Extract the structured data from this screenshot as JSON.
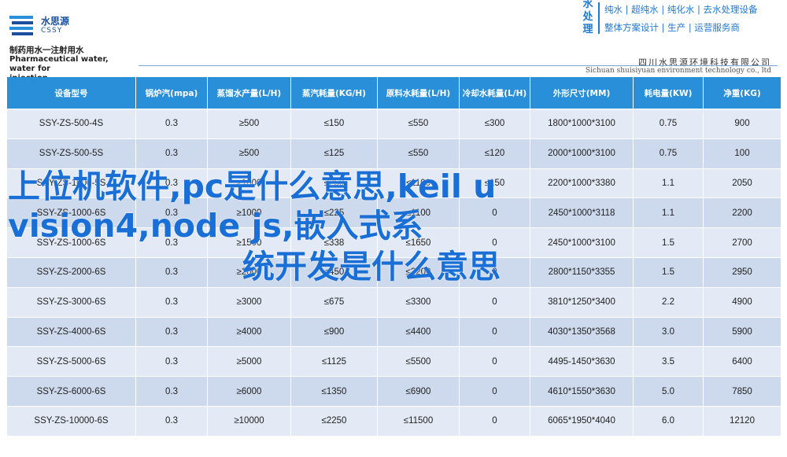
{
  "header": {
    "logo_cn": "水思源",
    "logo_en": "CSSY",
    "brand_vertical": [
      "水",
      "处",
      "理"
    ],
    "brand_line1": "纯水 | 超纯水 | 纯化水 | 去水处理设备",
    "brand_line2": "整体方案设计 | 生产 | 运营服务商",
    "product_title_cn": "制药用水一注射用水",
    "product_title_en1": "Pharmaceutical water, water for",
    "product_title_en2": "injection",
    "company_cn": "四川水思源环境科技有限公司",
    "company_en": "Sichuan shuisiyuan environment technology co., ltd"
  },
  "table": {
    "columns": [
      "设备型号",
      "锅炉汽(mpa)",
      "蒸馏水产量(L/H)",
      "蒸汽耗量(KG/H)",
      "原料水耗量(L/H)",
      "冷却水耗量(L/H)",
      "外形尺寸(MM)",
      "耗电量(KW)",
      "净重(KG)"
    ],
    "rows": [
      [
        "SSY-ZS-500-4S",
        "0.3",
        "≥500",
        "≤150",
        "≤550",
        "≤300",
        "1800*1000*3100",
        "0.75",
        "900"
      ],
      [
        "SSY-ZS-500-5S",
        "0.3",
        "≥500",
        "≤125",
        "≤550",
        "≤120",
        "2000*1000*3100",
        "0.75",
        "100"
      ],
      [
        "SSY-ZS-1000-5S",
        "0.3",
        "≥1000",
        "≤250",
        "≤1100",
        "≤150",
        "2200*1000*3380",
        "1.1",
        "2050"
      ],
      [
        "SSY-ZS-1000-6S",
        "0.3",
        "≥1000",
        "≤225",
        "≤1100",
        "0",
        "2450*1000*3118",
        "1.1",
        "2200"
      ],
      [
        "SSY-ZS-1000-6S",
        "0.3",
        "≥1500",
        "≤338",
        "≤1650",
        "0",
        "2450*1000*3100",
        "1.5",
        "2700"
      ],
      [
        "SSY-ZS-2000-6S",
        "0.3",
        "≥2000",
        "≤450",
        "≤2200",
        "0",
        "2800*1150*3355",
        "1.5",
        "2950"
      ],
      [
        "SSY-ZS-3000-6S",
        "0.3",
        "≥3000",
        "≤675",
        "≤3300",
        "0",
        "3810*1250*3400",
        "2.2",
        "4900"
      ],
      [
        "SSY-ZS-4000-6S",
        "0.3",
        "≥4000",
        "≤900",
        "≤4400",
        "0",
        "4030*1350*3568",
        "3.0",
        "5900"
      ],
      [
        "SSY-ZS-5000-6S",
        "0.3",
        "≥5000",
        "≤1125",
        "≤5500",
        "0",
        "4495-1450*3630",
        "3.5",
        "6400"
      ],
      [
        "SSY-ZS-6000-6S",
        "0.3",
        "≥6000",
        "≤1350",
        "≤6900",
        "0",
        "4610*1550*3630",
        "5.0",
        "7850"
      ],
      [
        "SSY-ZS-10000-6S",
        "0.3",
        "≥10000",
        "≤2250",
        "≤11500",
        "0",
        "6065*1950*4040",
        "6.0",
        "12120"
      ]
    ]
  },
  "overlay": {
    "line1": "上位机软件,pc是什么意思,keil u",
    "line2": "vision4,node js,嵌入式系",
    "line3": "统开发是什么意思"
  },
  "colors": {
    "header_blue": "#2a8fd9",
    "row_light": "#e3eaf5",
    "row_dark": "#cdd9ec",
    "overlay_text": "#1a6fd6",
    "brand": "#1f78d1"
  }
}
